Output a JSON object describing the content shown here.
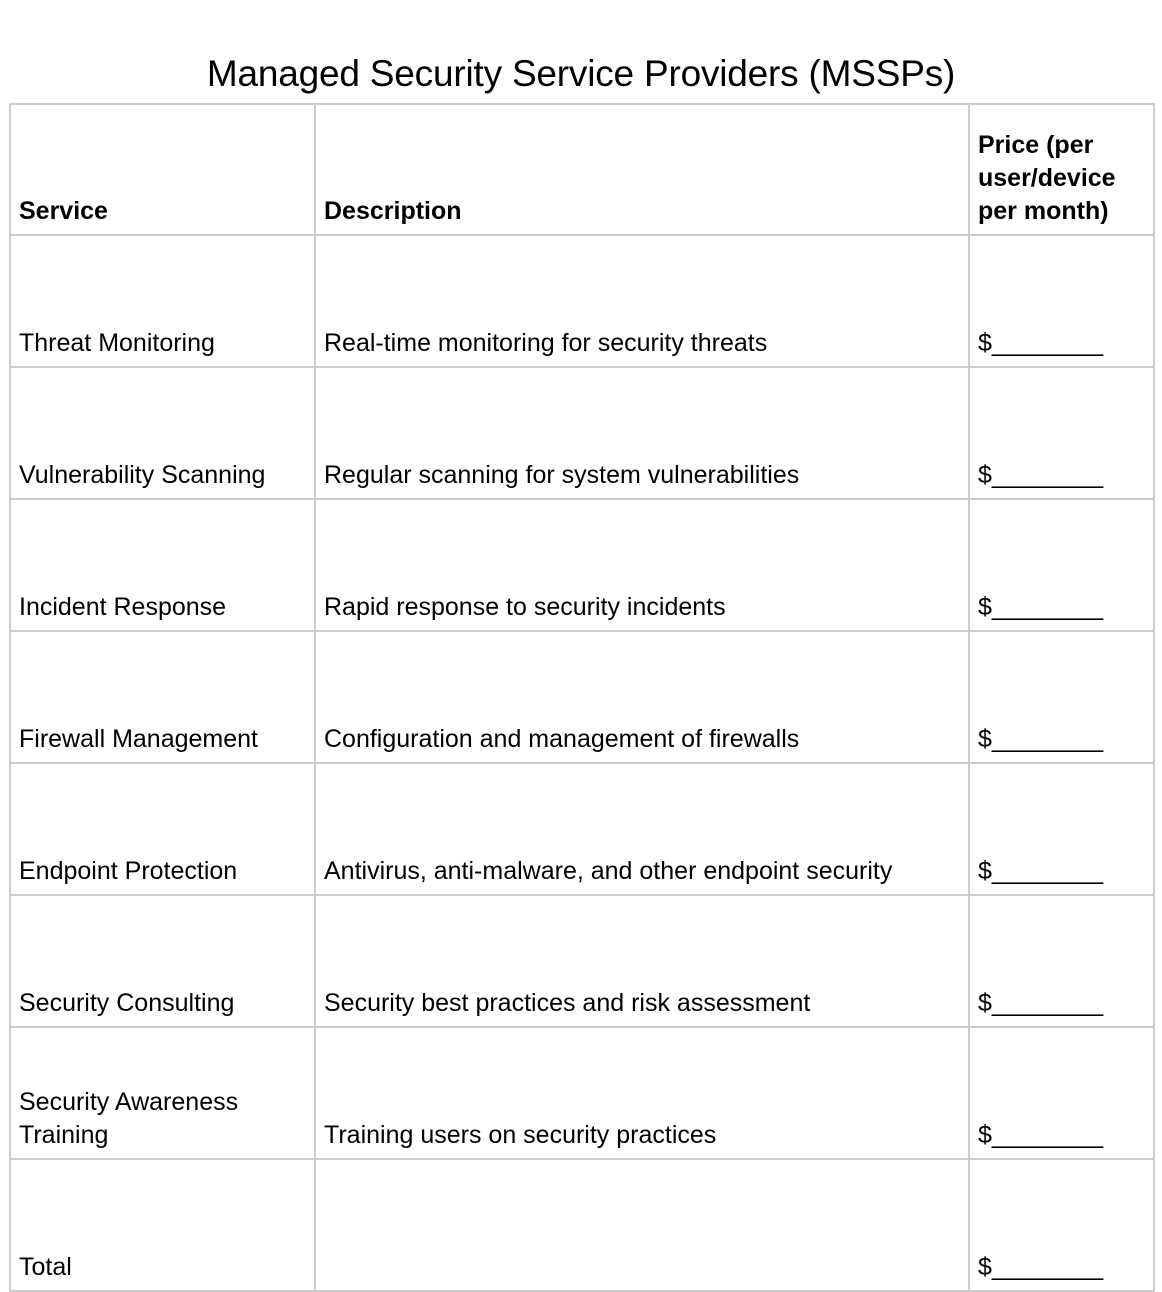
{
  "document": {
    "title": "Managed Security Service Providers (MSSPs)"
  },
  "table": {
    "columns": [
      {
        "key": "service",
        "label": "Service"
      },
      {
        "key": "description",
        "label": "Description"
      },
      {
        "key": "price",
        "label": "Price (per user/device per month)"
      }
    ],
    "price_blank_value": "$________",
    "rows": [
      {
        "service": "Threat Monitoring",
        "description": "Real-time monitoring for security threats",
        "price": "$________"
      },
      {
        "service": "Vulnerability Scanning",
        "description": "Regular scanning for system vulnerabilities",
        "price": "$________"
      },
      {
        "service": "Incident Response",
        "description": "Rapid response to security incidents",
        "price": "$________"
      },
      {
        "service": "Firewall Management",
        "description": "Configuration and management of firewalls",
        "price": "$________"
      },
      {
        "service": "Endpoint Protection",
        "description": "Antivirus, anti-malware, and other endpoint security",
        "price": "$________"
      },
      {
        "service": "Security Consulting",
        "description": "Security best practices and risk assessment",
        "price": "$________"
      },
      {
        "service": "Security Awareness Training",
        "description": "Training users on security practices",
        "price": "$________"
      },
      {
        "service": "Total",
        "description": "",
        "price": "$________"
      }
    ]
  },
  "style": {
    "border_color": "#cccccc",
    "text_color": "#000000",
    "background_color": "#ffffff"
  }
}
